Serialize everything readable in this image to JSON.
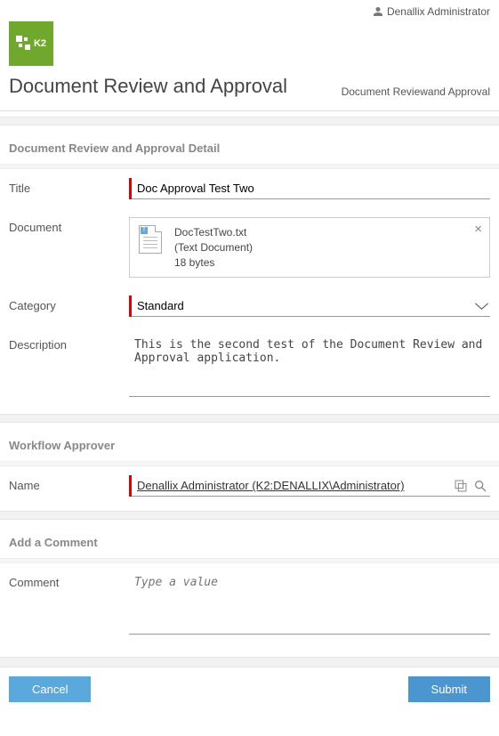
{
  "user": {
    "name": "Denallix Administrator"
  },
  "logo": {
    "text": "K2"
  },
  "page": {
    "title": "Document Review and Approval",
    "breadcrumb": "Document Reviewand Approval"
  },
  "sections": {
    "detail": {
      "header": "Document Review and Approval Detail"
    },
    "approver": {
      "header": "Workflow Approver"
    },
    "comment": {
      "header": "Add a Comment"
    }
  },
  "fields": {
    "title": {
      "label": "Title",
      "value": "Doc Approval Test Two"
    },
    "document": {
      "label": "Document",
      "filename": "DocTestTwo.txt",
      "filetype": "(Text Document)",
      "filesize": "18 bytes"
    },
    "category": {
      "label": "Category",
      "value": "Standard"
    },
    "description": {
      "label": "Description",
      "value": "This is the second test of the Document Review and Approval application."
    },
    "name": {
      "label": "Name",
      "value": "Denallix Administrator (K2:DENALLIX\\Administrator)"
    },
    "comment": {
      "label": "Comment",
      "placeholder": "Type a value"
    }
  },
  "buttons": {
    "cancel": "Cancel",
    "submit": "Submit"
  }
}
